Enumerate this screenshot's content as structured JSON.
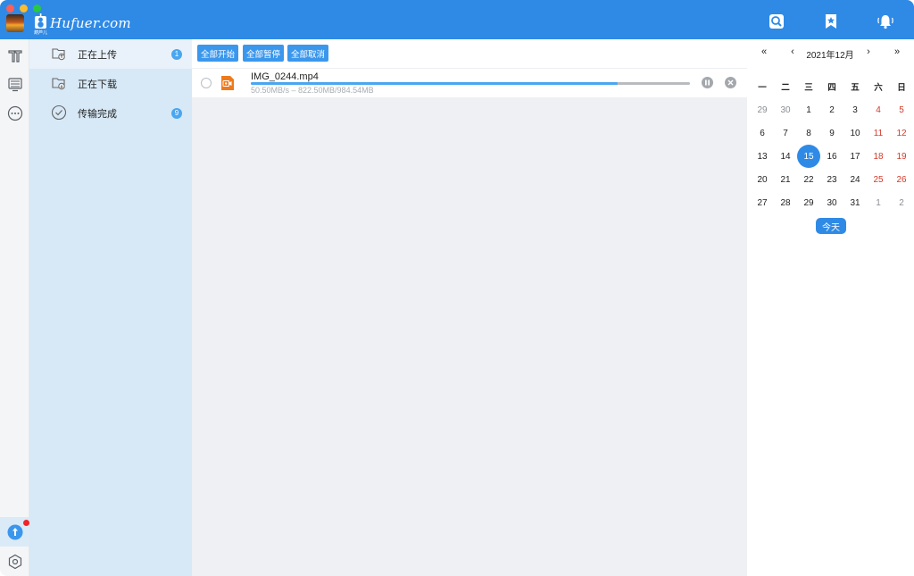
{
  "app": {
    "logo_text": "Hufuer.com",
    "logo_sub": "葫芦儿"
  },
  "colors": {
    "brand": "#2f8ae6",
    "accent": "#4aa6ef",
    "weekend": "#d23a2a",
    "badge_dot": "#f0242a"
  },
  "titlebar": {
    "icons": [
      "search-disk-icon",
      "bookmark-star-icon",
      "bell-icon"
    ]
  },
  "rail": {
    "items": [
      "files-icon",
      "device-icon",
      "more-icon",
      "transfer-icon",
      "settings-icon"
    ],
    "active": "transfer-icon",
    "has_notification": true
  },
  "nav": {
    "items": [
      {
        "label": "正在上传",
        "badge": "1",
        "icon": "upload-folder-icon",
        "active": true
      },
      {
        "label": "正在下载",
        "badge": "",
        "icon": "download-folder-icon",
        "active": false
      },
      {
        "label": "传输完成",
        "badge": "9",
        "icon": "check-circle-icon",
        "active": false
      }
    ]
  },
  "toolbar": {
    "start_all": "全部开始",
    "pause_all": "全部暂停",
    "cancel_all": "全部取消"
  },
  "tasks": [
    {
      "name": "IMG_0244.mp4",
      "meta": "50.50MB/s – 822.50MB/984.54MB",
      "progress": 0.835,
      "file_icon": "video-file-icon"
    }
  ],
  "calendar": {
    "prev_year": "«",
    "prev_month": "‹",
    "title": "2021年12月",
    "next_month": "›",
    "next_year": "»",
    "weekdays": [
      "一",
      "二",
      "三",
      "四",
      "五",
      "六",
      "日"
    ],
    "weeks": [
      [
        "29",
        "30",
        "1",
        "2",
        "3",
        "4",
        "5"
      ],
      [
        "6",
        "7",
        "8",
        "9",
        "10",
        "11",
        "12"
      ],
      [
        "13",
        "14",
        "15",
        "16",
        "17",
        "18",
        "19"
      ],
      [
        "20",
        "21",
        "22",
        "23",
        "24",
        "25",
        "26"
      ],
      [
        "27",
        "28",
        "29",
        "30",
        "31",
        "1",
        "2"
      ]
    ],
    "selected": "15",
    "today_label": "今天"
  }
}
